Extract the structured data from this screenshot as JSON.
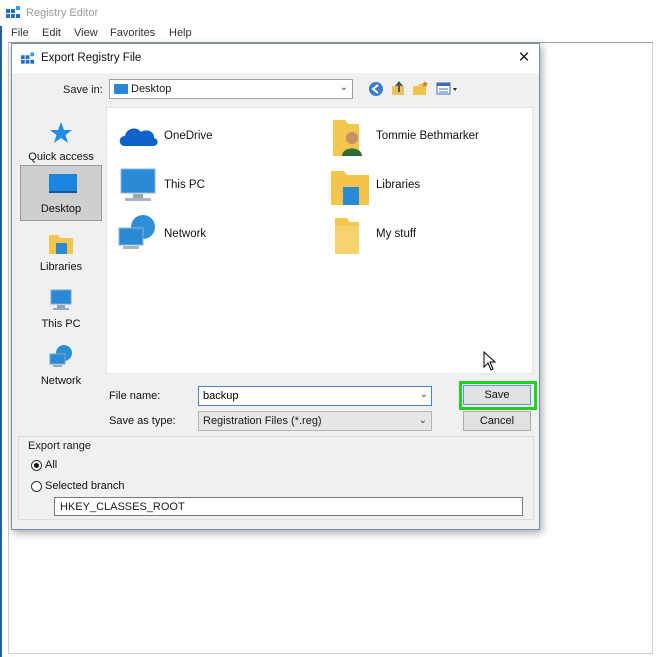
{
  "registry_editor": {
    "title": "Registry Editor",
    "menu": [
      "File",
      "Edit",
      "View",
      "Favorites",
      "Help"
    ]
  },
  "dialog": {
    "title": "Export Registry File",
    "close_glyph": "✕",
    "save_in_label": "Save in:",
    "save_in_value": "Desktop",
    "places": [
      {
        "label": "Quick access",
        "icon": "star-icon"
      },
      {
        "label": "Desktop",
        "icon": "desktop-icon",
        "selected": true
      },
      {
        "label": "Libraries",
        "icon": "libraries-folder-icon"
      },
      {
        "label": "This PC",
        "icon": "computer-icon"
      },
      {
        "label": "Network",
        "icon": "network-icon"
      }
    ],
    "files": [
      {
        "name": "OneDrive",
        "icon": "onedrive-cloud-icon"
      },
      {
        "name": "Tommie Bethmarker",
        "icon": "user-folder-icon"
      },
      {
        "name": "This PC",
        "icon": "computer-icon"
      },
      {
        "name": "Libraries",
        "icon": "libraries-folder-icon"
      },
      {
        "name": "Network",
        "icon": "network-icon"
      },
      {
        "name": "My stuff",
        "icon": "folder-icon"
      }
    ],
    "file_name_label": "File name:",
    "file_name_value": "backup",
    "save_as_type_label": "Save as type:",
    "save_as_type_value": "Registration Files (*.reg)",
    "save_button": "Save",
    "cancel_button": "Cancel",
    "export_range": {
      "label": "Export range",
      "all_label": "All",
      "selected_branch_label": "Selected branch",
      "branch_value": "HKEY_CLASSES_ROOT",
      "selected": "All"
    }
  },
  "colors": {
    "highlight": "#1ed41e",
    "accent": "#1f5fa8"
  }
}
